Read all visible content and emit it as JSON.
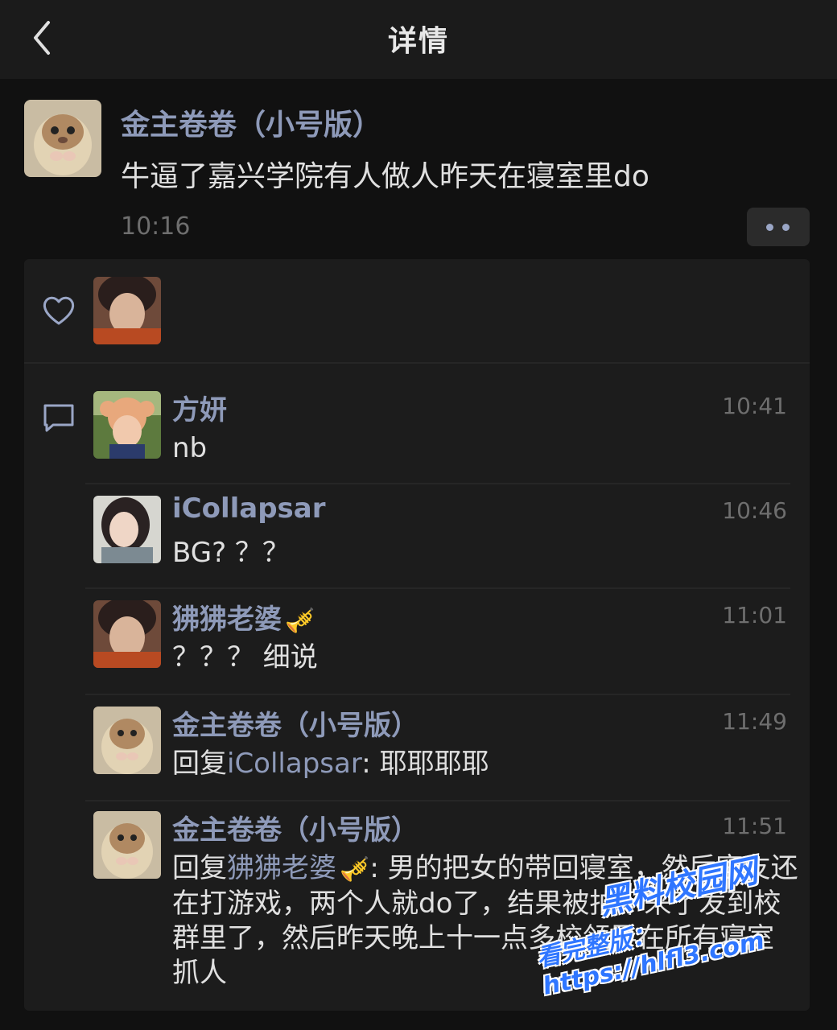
{
  "header": {
    "title": "详情",
    "back_icon": "chevron-left-icon"
  },
  "post": {
    "author": "金主卷卷（小号版）",
    "text": "牛逼了嘉兴学院有人做人昨天在寝室里do",
    "time": "10:16",
    "more_icon": "more-dots-icon"
  },
  "likes": {
    "icon": "heart-icon"
  },
  "comments_icon": "comment-icon",
  "comments": [
    {
      "name": "方妍",
      "time": "10:41",
      "text": "nb"
    },
    {
      "name": "iCollapsar",
      "time": "10:46",
      "text": "BG? ？？"
    },
    {
      "name": "狒狒老婆",
      "time": "11:01",
      "text": "？？？ 细说"
    },
    {
      "name": "金主卷卷（小号版）",
      "time": "11:49",
      "reply_prefix": "回复",
      "reply_to": "iCollapsar",
      "text": ": 耶耶耶耶"
    },
    {
      "name": "金主卷卷（小号版）",
      "time": "11:51",
      "reply_prefix": "回复",
      "reply_to": "狒狒老婆",
      "text": ": 男的把女的带回寝室，然后室友还在打游戏，两个人就do了，结果被拍下来了发到校群里了，然后昨天晚上十一点多校领导在所有寝室抓人"
    }
  ],
  "watermark": {
    "line1": "黑料校园网",
    "line2": "看完整版：https://hlfl3.com"
  },
  "colors": {
    "accent": "#8e9ab9",
    "background": "#111111",
    "panel": "#1c1c1c"
  }
}
